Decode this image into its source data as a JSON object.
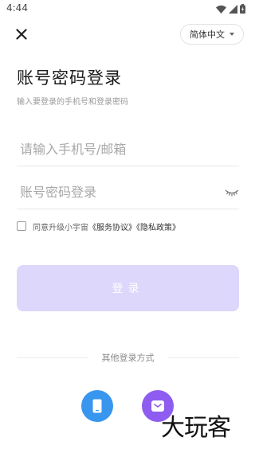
{
  "status_bar": {
    "time": "4:44"
  },
  "header": {
    "language_label": "简体中文"
  },
  "title": "账号密码登录",
  "subtitle": "输入要登录的手机号和登录密码",
  "form": {
    "account_placeholder": "请输入手机号/邮箱",
    "password_placeholder": "账号密码登录"
  },
  "agreement": {
    "prefix": "同意升级小宇宙",
    "service_link": "《服务协议》",
    "privacy_link": "《隐私政策》"
  },
  "login_button": "登录",
  "other_methods_label": "其他登录方式",
  "watermark": "大玩客",
  "colors": {
    "primary_disabled": "#dcd7fb",
    "phone_button": "#3896ee",
    "email_button": "#8e5cf0"
  }
}
